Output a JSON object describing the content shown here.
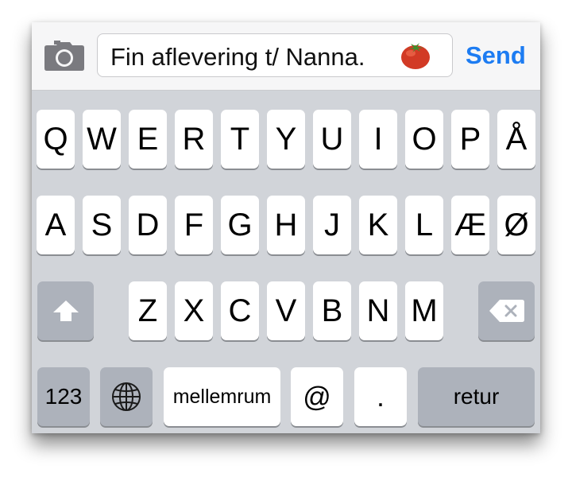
{
  "message": {
    "text": "Fin aflevering t/ Nanna.",
    "emoji_icon": "tomato-emoji-icon"
  },
  "send_label": "Send",
  "camera_icon": "camera-icon",
  "keyboard": {
    "row1": [
      "Q",
      "W",
      "E",
      "R",
      "T",
      "Y",
      "U",
      "I",
      "O",
      "P",
      "Å"
    ],
    "row2": [
      "A",
      "S",
      "D",
      "F",
      "G",
      "H",
      "J",
      "K",
      "L",
      "Æ",
      "Ø"
    ],
    "row3": [
      "Z",
      "X",
      "C",
      "V",
      "B",
      "N",
      "M"
    ],
    "numbers_label": "123",
    "space_label": "mellemrum",
    "at_label": "@",
    "period_label": ".",
    "return_label": "retur",
    "shift_icon": "shift-arrow-icon",
    "delete_icon": "backspace-icon",
    "globe_icon": "globe-icon"
  },
  "colors": {
    "accent": "#1d7cf2",
    "keyboard_bg": "#d1d4d9",
    "function_key": "#adb2bb",
    "key": "#ffffff"
  }
}
